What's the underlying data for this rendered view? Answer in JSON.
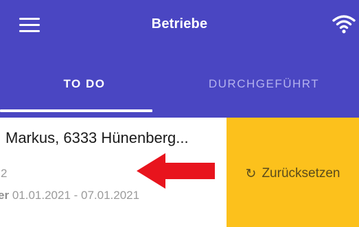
{
  "header": {
    "title": "Betriebe",
    "menu_icon": "hamburger-menu-icon",
    "status_icon": "wifi-icon",
    "bar_color": "#4a46c2"
  },
  "tabs": [
    {
      "label": "TO DO",
      "active": true
    },
    {
      "label": "DURCHGEFÜHRT",
      "active": false
    }
  ],
  "list": {
    "item": {
      "name": "Markus, 6333 Hünenberg...",
      "number": "2",
      "period_prefix": "er",
      "period": "01.01.2021 - 07.01.2021"
    },
    "swipe_action": {
      "label": "Zurücksetzen",
      "icon": "reset-icon",
      "icon_glyph": "↻",
      "color": "#fcc11c"
    }
  },
  "annotation": {
    "icon": "red-arrow-icon",
    "color": "#e8141d"
  }
}
